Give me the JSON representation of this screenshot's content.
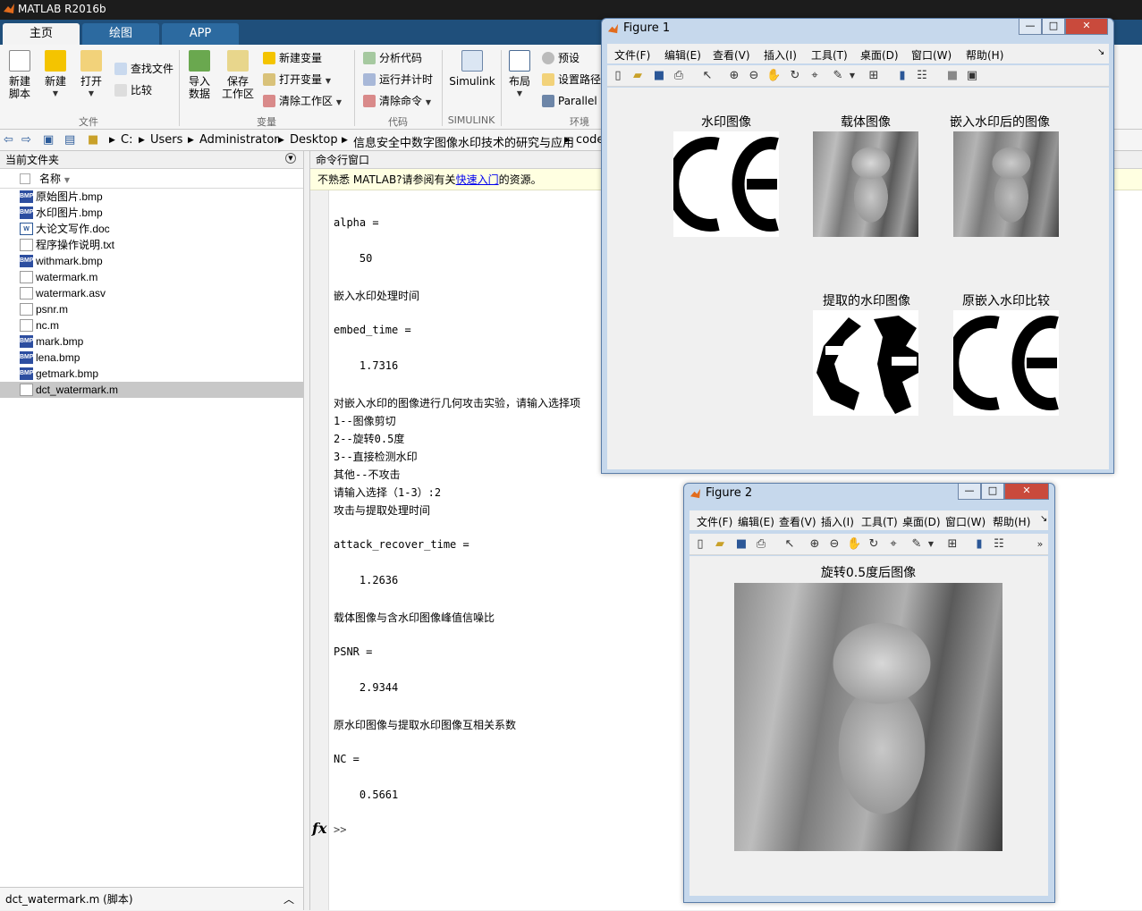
{
  "app": {
    "title": "MATLAB R2016b"
  },
  "ribbon": {
    "tabs": [
      "主页",
      "绘图",
      "APP"
    ],
    "new_script": "新建\n脚本",
    "new": "新建",
    "open": "打开",
    "find_files": "查找文件",
    "compare": "比较",
    "import_data": "导入\n数据",
    "save_workspace": "保存\n工作区",
    "new_variable": "新建变量",
    "open_variable": "打开变量",
    "clear_workspace": "清除工作区",
    "analyze_code": "分析代码",
    "run_time": "运行并计时",
    "clear_commands": "清除命令",
    "simulink": "Simulink",
    "layout": "布局",
    "preferences": "预设",
    "set_path": "设置路径",
    "parallel": "Parallel",
    "groups": {
      "file": "文件",
      "variable": "变量",
      "code": "代码",
      "simulink": "SIMULINK",
      "env": "环境"
    }
  },
  "address": {
    "crumbs": [
      "C:",
      "Users",
      "Administrator",
      "Desktop",
      "信息安全中数字图像水印技术的研究与应用",
      "code"
    ]
  },
  "file_panel": {
    "title": "当前文件夹",
    "column": "名称",
    "files": [
      {
        "name": "原始图片.bmp",
        "type": "bmp"
      },
      {
        "name": "水印图片.bmp",
        "type": "bmp"
      },
      {
        "name": "大论文写作.doc",
        "type": "doc"
      },
      {
        "name": "程序操作说明.txt",
        "type": "txt"
      },
      {
        "name": "withmark.bmp",
        "type": "bmp"
      },
      {
        "name": "watermark.m",
        "type": "m"
      },
      {
        "name": "watermark.asv",
        "type": "txt"
      },
      {
        "name": "psnr.m",
        "type": "m"
      },
      {
        "name": "nc.m",
        "type": "m"
      },
      {
        "name": "mark.bmp",
        "type": "bmp"
      },
      {
        "name": "lena.bmp",
        "type": "bmp"
      },
      {
        "name": "getmark.bmp",
        "type": "bmp"
      },
      {
        "name": "dct_watermark.m",
        "type": "m",
        "selected": true
      }
    ],
    "footer": "dct_watermark.m  (脚本)"
  },
  "command_window": {
    "title": "命令行窗口",
    "tip_prefix": "不熟悉 MATLAB?请参阅有关",
    "tip_link": "快速入门",
    "tip_suffix": "的资源。",
    "lines": [
      "alpha =",
      "    50",
      "嵌入水印处理时间",
      "embed_time =",
      "    1.7316",
      "对嵌入水印的图像进行几何攻击实验，请输入选择项",
      "1--图像剪切",
      "2--旋转0.5度",
      "3--直接检测水印",
      "其他--不攻击",
      "请输入选择（1-3）:2",
      "攻击与提取处理时间",
      "attack_recover_time =",
      "    1.2636",
      "载体图像与含水印图像峰值信噪比",
      "PSNR =",
      "    2.9344",
      "原水印图像与提取水印图像互相关系数",
      "NC =",
      "    0.5661"
    ],
    "prompt": ">>",
    "fx": "fx"
  },
  "figure1": {
    "title": "Figure 1",
    "menu": [
      "文件(F)",
      "编辑(E)",
      "查看(V)",
      "插入(I)",
      "工具(T)",
      "桌面(D)",
      "窗口(W)",
      "帮助(H)"
    ],
    "axes_titles": [
      "水印图像",
      "载体图像",
      "嵌入水印后的图像",
      "提取的水印图像",
      "原嵌入水印比较"
    ]
  },
  "figure2": {
    "title": "Figure 2",
    "menu": [
      "文件(F)",
      "编辑(E)",
      "查看(V)",
      "插入(I)",
      "工具(T)",
      "桌面(D)",
      "窗口(W)",
      "帮助(H)"
    ],
    "axes_title": "旋转0.5度后图像"
  }
}
